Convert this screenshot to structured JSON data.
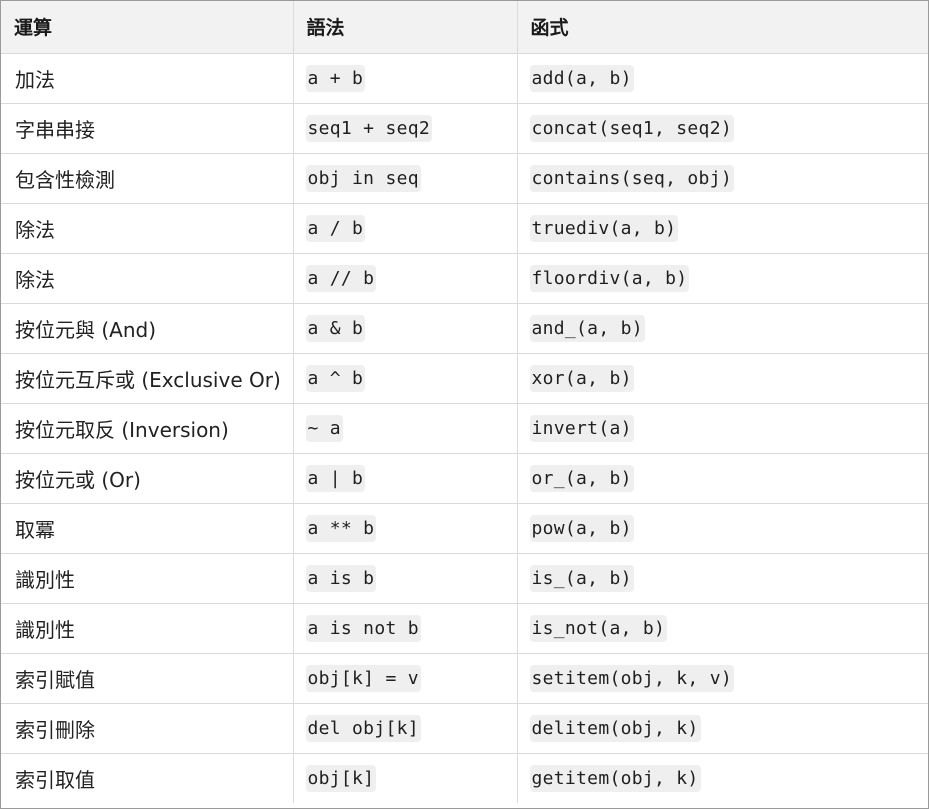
{
  "headers": {
    "operation": "運算",
    "syntax": "語法",
    "function": "函式"
  },
  "rows": [
    {
      "operation": "加法",
      "syntax": "a + b",
      "function": "add(a, b)"
    },
    {
      "operation": "字串串接",
      "syntax": "seq1 + seq2",
      "function": "concat(seq1, seq2)"
    },
    {
      "operation": "包含性檢測",
      "syntax": "obj in seq",
      "function": "contains(seq, obj)"
    },
    {
      "operation": "除法",
      "syntax": "a / b",
      "function": "truediv(a, b)"
    },
    {
      "operation": "除法",
      "syntax": "a // b",
      "function": "floordiv(a, b)"
    },
    {
      "operation": "按位元與 (And)",
      "syntax": "a & b",
      "function": "and_(a, b)"
    },
    {
      "operation": "按位元互斥或 (Exclusive Or)",
      "syntax": "a ^ b",
      "function": "xor(a, b)"
    },
    {
      "operation": "按位元取反 (Inversion)",
      "syntax": "~ a",
      "function": "invert(a)"
    },
    {
      "operation": "按位元或 (Or)",
      "syntax": "a | b",
      "function": "or_(a, b)"
    },
    {
      "operation": "取冪",
      "syntax": "a ** b",
      "function": "pow(a, b)"
    },
    {
      "operation": "識別性",
      "syntax": "a is b",
      "function": "is_(a, b)"
    },
    {
      "operation": "識別性",
      "syntax": "a is not b",
      "function": "is_not(a, b)"
    },
    {
      "operation": "索引賦值",
      "syntax": "obj[k] = v",
      "function": "setitem(obj, k, v)"
    },
    {
      "operation": "索引刪除",
      "syntax": "del obj[k]",
      "function": "delitem(obj, k)"
    },
    {
      "operation": "索引取值",
      "syntax": "obj[k]",
      "function": "getitem(obj, k)"
    }
  ]
}
